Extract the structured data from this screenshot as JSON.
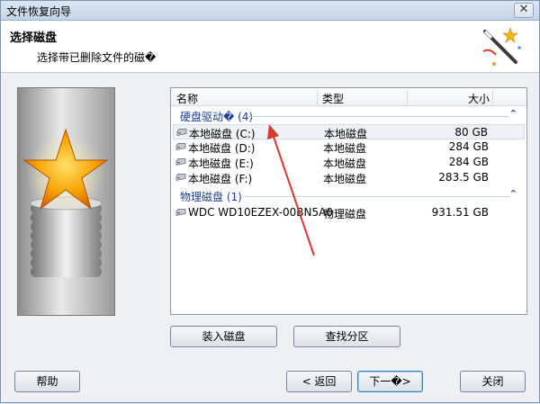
{
  "window": {
    "title": "文件恢复向导",
    "close_label": "✕"
  },
  "header": {
    "title": "选择磁盘",
    "subtitle": "选择带已删除文件的磁�"
  },
  "list": {
    "columns": {
      "name": "名称",
      "type": "类型",
      "size": "大小"
    },
    "groups": [
      {
        "label": "硬盘驱动� (4)",
        "collapse": "⌃",
        "rows": [
          {
            "name": "本地磁盘 (C:)",
            "type": "本地磁盘",
            "size": "80 GB",
            "selected": true
          },
          {
            "name": "本地磁盘 (D:)",
            "type": "本地磁盘",
            "size": "284 GB"
          },
          {
            "name": "本地磁盘 (E:)",
            "type": "本地磁盘",
            "size": "284 GB"
          },
          {
            "name": "本地磁盘 (F:)",
            "type": "本地磁盘",
            "size": "283.5 GB"
          }
        ]
      },
      {
        "label": "物理磁盘 (1)",
        "collapse": "⌃",
        "rows": [
          {
            "name": "WDC WD10EZEX-00BN5A0",
            "type": "物理磁盘",
            "size": "931.51 GB"
          }
        ]
      }
    ]
  },
  "buttons": {
    "load_disk": "装入磁盘",
    "find_partition": "查找分区",
    "help": "帮助",
    "back": "< 返回",
    "next": "下一�>",
    "close": "关闭"
  },
  "colors": {
    "group_text": "#1e3c96",
    "annotation_arrow": "#d63a2f"
  }
}
